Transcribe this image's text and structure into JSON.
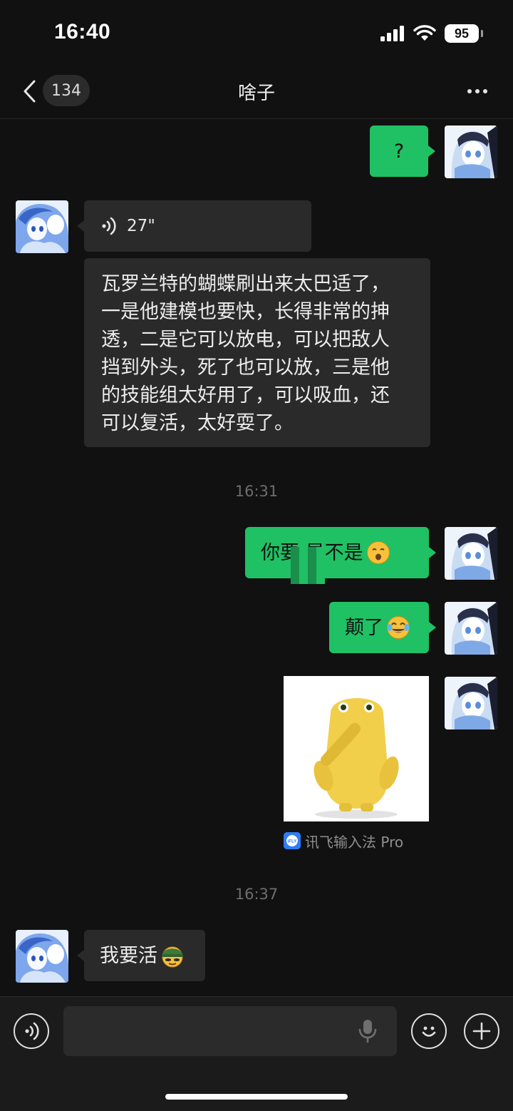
{
  "status_bar": {
    "time": "16:40",
    "battery": "95"
  },
  "nav": {
    "unread_count": "134",
    "title": "啥子"
  },
  "messages": {
    "m1": {
      "text": "?"
    },
    "m2": {
      "voice_duration": "27\""
    },
    "m3": {
      "text": "瓦罗兰特的蝴蝶刷出来太巴适了，\n一是他建模也要快，长得非常的抻\n透，二是它可以放电，可以把敌人\n挡到外头，死了也可以放，三是他\n的技能组太好用了，可以吸血，还\n可以复活，太好耍了。"
    },
    "ts1": "16:31",
    "m4": {
      "text": "你要      是不是",
      "emoji": "kiss-face-emoji"
    },
    "m5": {
      "text": "颠了",
      "emoji": "tears-of-joy-emoji"
    },
    "m6": {
      "sticker": "yellow-figure-sticker",
      "source": "讯飞输入法 Pro",
      "source_logo_text": "iFLY"
    },
    "ts2": "16:37",
    "m7": {
      "text": "我要活",
      "emoji": "helmet-face-emoji"
    }
  },
  "input": {
    "placeholder": ""
  },
  "colors": {
    "background": "#111111",
    "my_bubble": "#20c064",
    "other_bubble": "#2a2a2a",
    "input_bar": "#1b1b1b"
  }
}
